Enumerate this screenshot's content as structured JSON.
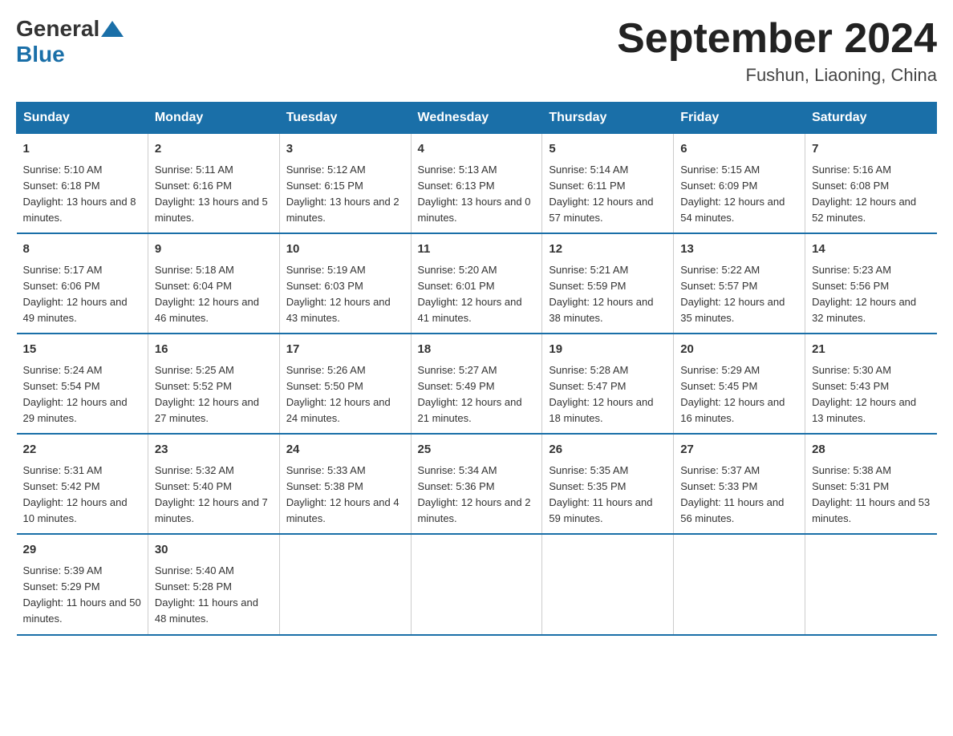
{
  "header": {
    "logo_general": "General",
    "logo_blue": "Blue",
    "month_title": "September 2024",
    "location": "Fushun, Liaoning, China"
  },
  "days_of_week": [
    "Sunday",
    "Monday",
    "Tuesday",
    "Wednesday",
    "Thursday",
    "Friday",
    "Saturday"
  ],
  "weeks": [
    [
      {
        "day": "1",
        "sunrise": "5:10 AM",
        "sunset": "6:18 PM",
        "daylight": "13 hours and 8 minutes."
      },
      {
        "day": "2",
        "sunrise": "5:11 AM",
        "sunset": "6:16 PM",
        "daylight": "13 hours and 5 minutes."
      },
      {
        "day": "3",
        "sunrise": "5:12 AM",
        "sunset": "6:15 PM",
        "daylight": "13 hours and 2 minutes."
      },
      {
        "day": "4",
        "sunrise": "5:13 AM",
        "sunset": "6:13 PM",
        "daylight": "13 hours and 0 minutes."
      },
      {
        "day": "5",
        "sunrise": "5:14 AM",
        "sunset": "6:11 PM",
        "daylight": "12 hours and 57 minutes."
      },
      {
        "day": "6",
        "sunrise": "5:15 AM",
        "sunset": "6:09 PM",
        "daylight": "12 hours and 54 minutes."
      },
      {
        "day": "7",
        "sunrise": "5:16 AM",
        "sunset": "6:08 PM",
        "daylight": "12 hours and 52 minutes."
      }
    ],
    [
      {
        "day": "8",
        "sunrise": "5:17 AM",
        "sunset": "6:06 PM",
        "daylight": "12 hours and 49 minutes."
      },
      {
        "day": "9",
        "sunrise": "5:18 AM",
        "sunset": "6:04 PM",
        "daylight": "12 hours and 46 minutes."
      },
      {
        "day": "10",
        "sunrise": "5:19 AM",
        "sunset": "6:03 PM",
        "daylight": "12 hours and 43 minutes."
      },
      {
        "day": "11",
        "sunrise": "5:20 AM",
        "sunset": "6:01 PM",
        "daylight": "12 hours and 41 minutes."
      },
      {
        "day": "12",
        "sunrise": "5:21 AM",
        "sunset": "5:59 PM",
        "daylight": "12 hours and 38 minutes."
      },
      {
        "day": "13",
        "sunrise": "5:22 AM",
        "sunset": "5:57 PM",
        "daylight": "12 hours and 35 minutes."
      },
      {
        "day": "14",
        "sunrise": "5:23 AM",
        "sunset": "5:56 PM",
        "daylight": "12 hours and 32 minutes."
      }
    ],
    [
      {
        "day": "15",
        "sunrise": "5:24 AM",
        "sunset": "5:54 PM",
        "daylight": "12 hours and 29 minutes."
      },
      {
        "day": "16",
        "sunrise": "5:25 AM",
        "sunset": "5:52 PM",
        "daylight": "12 hours and 27 minutes."
      },
      {
        "day": "17",
        "sunrise": "5:26 AM",
        "sunset": "5:50 PM",
        "daylight": "12 hours and 24 minutes."
      },
      {
        "day": "18",
        "sunrise": "5:27 AM",
        "sunset": "5:49 PM",
        "daylight": "12 hours and 21 minutes."
      },
      {
        "day": "19",
        "sunrise": "5:28 AM",
        "sunset": "5:47 PM",
        "daylight": "12 hours and 18 minutes."
      },
      {
        "day": "20",
        "sunrise": "5:29 AM",
        "sunset": "5:45 PM",
        "daylight": "12 hours and 16 minutes."
      },
      {
        "day": "21",
        "sunrise": "5:30 AM",
        "sunset": "5:43 PM",
        "daylight": "12 hours and 13 minutes."
      }
    ],
    [
      {
        "day": "22",
        "sunrise": "5:31 AM",
        "sunset": "5:42 PM",
        "daylight": "12 hours and 10 minutes."
      },
      {
        "day": "23",
        "sunrise": "5:32 AM",
        "sunset": "5:40 PM",
        "daylight": "12 hours and 7 minutes."
      },
      {
        "day": "24",
        "sunrise": "5:33 AM",
        "sunset": "5:38 PM",
        "daylight": "12 hours and 4 minutes."
      },
      {
        "day": "25",
        "sunrise": "5:34 AM",
        "sunset": "5:36 PM",
        "daylight": "12 hours and 2 minutes."
      },
      {
        "day": "26",
        "sunrise": "5:35 AM",
        "sunset": "5:35 PM",
        "daylight": "11 hours and 59 minutes."
      },
      {
        "day": "27",
        "sunrise": "5:37 AM",
        "sunset": "5:33 PM",
        "daylight": "11 hours and 56 minutes."
      },
      {
        "day": "28",
        "sunrise": "5:38 AM",
        "sunset": "5:31 PM",
        "daylight": "11 hours and 53 minutes."
      }
    ],
    [
      {
        "day": "29",
        "sunrise": "5:39 AM",
        "sunset": "5:29 PM",
        "daylight": "11 hours and 50 minutes."
      },
      {
        "day": "30",
        "sunrise": "5:40 AM",
        "sunset": "5:28 PM",
        "daylight": "11 hours and 48 minutes."
      },
      {
        "day": "",
        "sunrise": "",
        "sunset": "",
        "daylight": ""
      },
      {
        "day": "",
        "sunrise": "",
        "sunset": "",
        "daylight": ""
      },
      {
        "day": "",
        "sunrise": "",
        "sunset": "",
        "daylight": ""
      },
      {
        "day": "",
        "sunrise": "",
        "sunset": "",
        "daylight": ""
      },
      {
        "day": "",
        "sunrise": "",
        "sunset": "",
        "daylight": ""
      }
    ]
  ]
}
